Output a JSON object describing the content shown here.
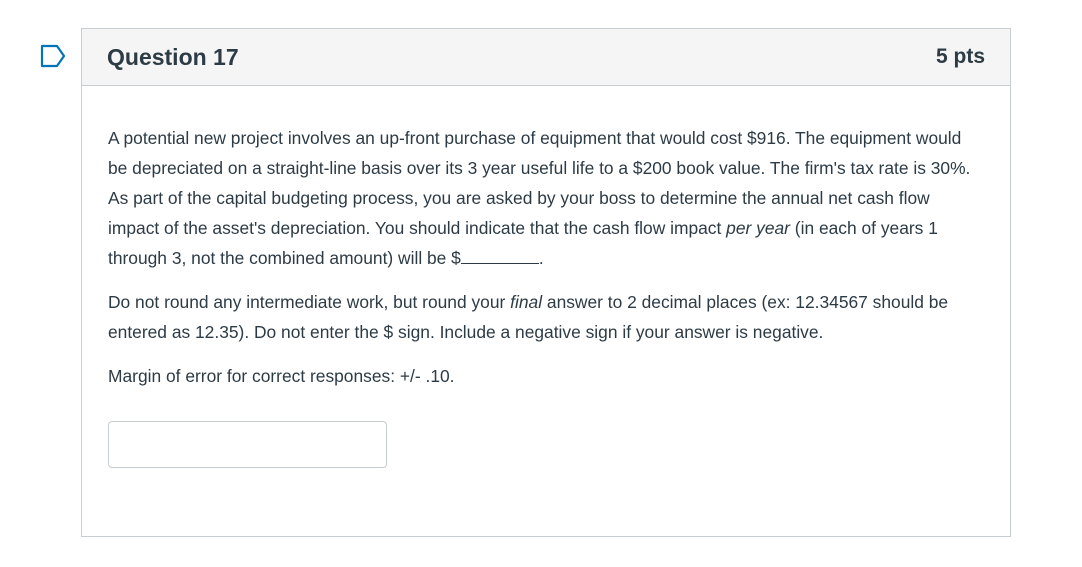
{
  "question": {
    "title": "Question 17",
    "points": "5 pts",
    "flag_icon": "flag-bookmark-icon",
    "p1_before_italic": "A potential new project involves an up-front purchase of equipment that would cost $916.  The equipment would be depreciated on a straight-line basis over its 3 year useful life to a $200 book value.  The firm's tax rate is 30%.  As part of the capital budgeting process, you are asked by your boss to determine the annual net cash flow impact of the asset's depreciation.  You should indicate that the cash flow impact ",
    "p1_italic": "per year",
    "p1_after_italic": " (in each of years 1 through 3, not the combined amount) will be $",
    "p1_end": ".",
    "p2_before_italic": "Do not round any intermediate work, but round your ",
    "p2_italic": "final",
    "p2_after_italic": " answer to 2 decimal places (ex: 12.34567 should be entered as 12.35).  Do not enter the $ sign.  Include a negative sign if your answer is negative.",
    "p3": "Margin of error for correct responses: +/- .10.",
    "answer_value": ""
  },
  "colors": {
    "accent": "#0374b5",
    "text": "#2d3b45",
    "border": "#c7cdd1",
    "header_bg": "#f5f5f5"
  }
}
